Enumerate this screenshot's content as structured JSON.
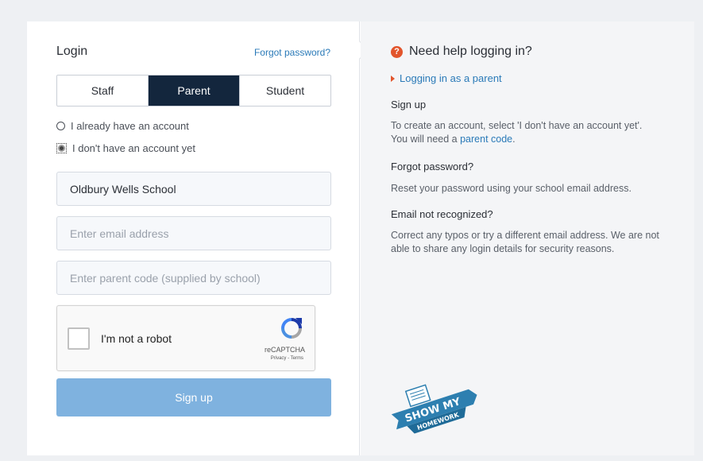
{
  "login": {
    "title": "Login",
    "forgot_link": "Forgot password?",
    "tabs": [
      {
        "label": "Staff",
        "active": false
      },
      {
        "label": "Parent",
        "active": true
      },
      {
        "label": "Student",
        "active": false
      }
    ],
    "radio_existing": "I already have an account",
    "radio_new": "I don't have an account yet",
    "school_value": "Oldbury Wells School",
    "email_placeholder": "Enter email address",
    "parent_code_placeholder": "Enter parent code (supplied by school)",
    "signup_label": "Sign up"
  },
  "captcha": {
    "label": "I'm not a robot",
    "brand": "reCAPTCHA",
    "terms": "Privacy - Terms"
  },
  "help": {
    "title": "Need help logging in?",
    "icon": "question-icon",
    "link": "Logging in as a parent",
    "sections": [
      {
        "heading": "Sign up",
        "body_pre": "To create an account, select 'I don't have an account yet'. You will need a ",
        "body_link": "parent code",
        "body_post": "."
      },
      {
        "heading": "Forgot password?",
        "body": "Reset your password using your school email address."
      },
      {
        "heading": "Email not recognized?",
        "body": "Correct any typos or try a different email address. We are not able to share any login details for security reasons."
      }
    ]
  },
  "logo": {
    "line1": "SHOW MY",
    "line2": "HOMEWORK"
  },
  "colors": {
    "accent": "#2a7ab8",
    "active_tab": "#13263d",
    "signup_button": "#7fb2df",
    "help_orange": "#e2552c"
  }
}
